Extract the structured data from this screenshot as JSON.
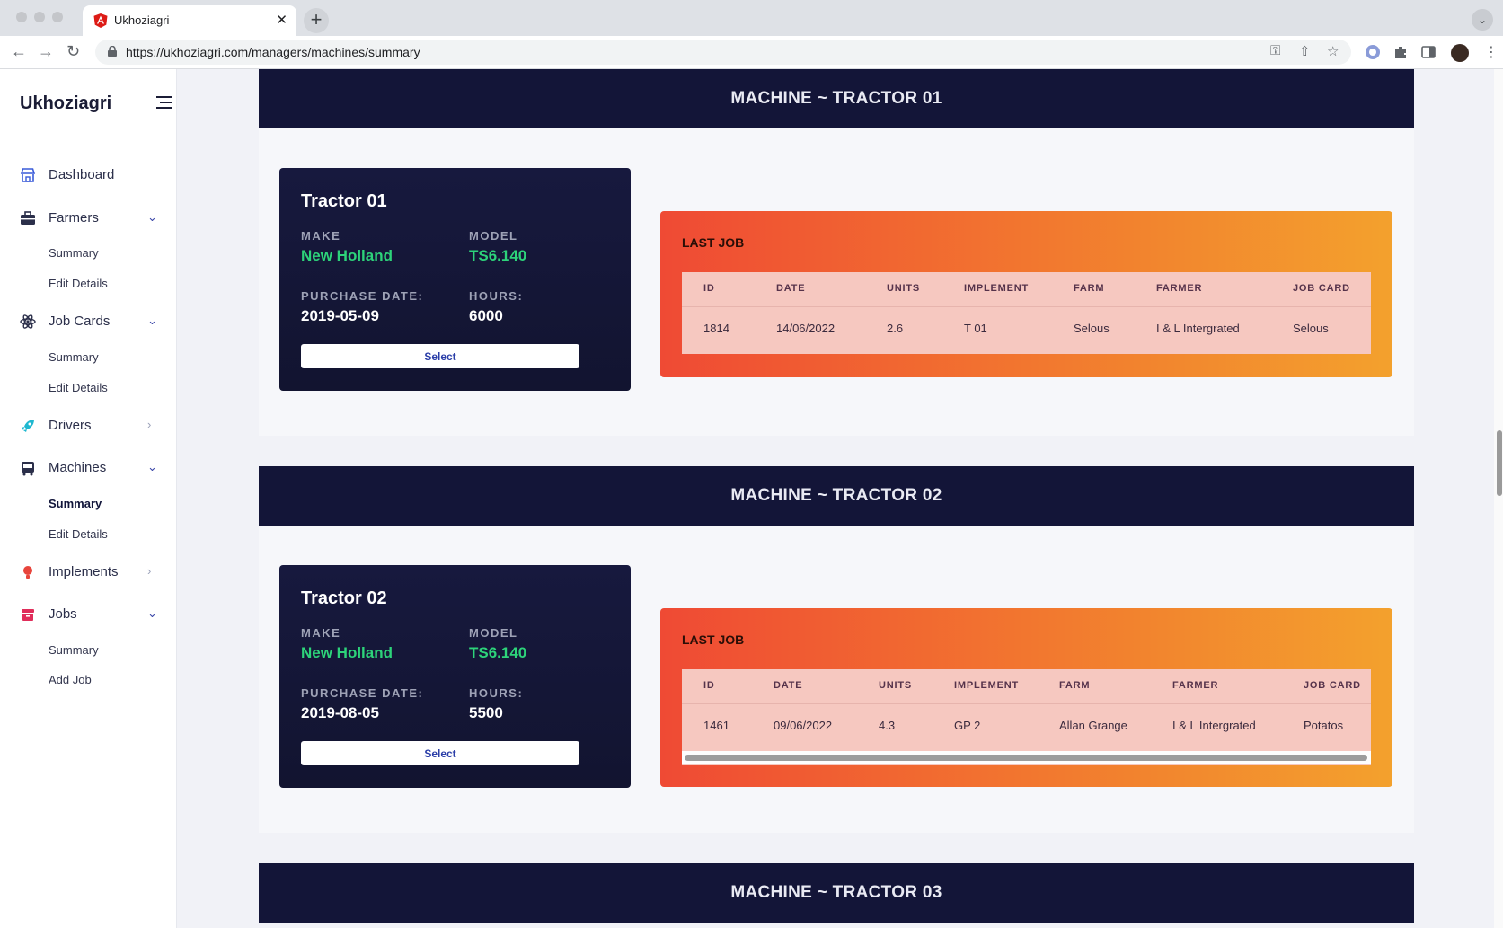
{
  "browser": {
    "tab_title": "Ukhoziagri",
    "url": "https://ukhoziagri.com/managers/machines/summary"
  },
  "sidebar": {
    "brand": "Ukhoziagri",
    "items": [
      {
        "label": "Dashboard",
        "icon": "store-icon",
        "color": "#3a5bd9"
      },
      {
        "label": "Farmers",
        "icon": "briefcase-icon",
        "color": "#2b2f4a",
        "expanded": true,
        "children": [
          "Summary",
          "Edit Details"
        ]
      },
      {
        "label": "Job Cards",
        "icon": "atom-icon",
        "color": "#2b2f4a",
        "expanded": true,
        "children": [
          "Summary",
          "Edit Details"
        ]
      },
      {
        "label": "Drivers",
        "icon": "rocket-icon",
        "color": "#1fb8d0",
        "expanded": false
      },
      {
        "label": "Machines",
        "icon": "bus-icon",
        "color": "#2b2f4a",
        "expanded": true,
        "children": [
          "Summary",
          "Edit Details"
        ],
        "active_child": "Summary"
      },
      {
        "label": "Implements",
        "icon": "bulb-icon",
        "color": "#e8453c",
        "expanded": false
      },
      {
        "label": "Jobs",
        "icon": "archive-icon",
        "color": "#e02d5a",
        "expanded": true,
        "children": [
          "Summary",
          "Add Job"
        ]
      }
    ]
  },
  "machines": [
    {
      "header": "MACHINE ~ TRACTOR 01",
      "name": "Tractor 01",
      "make_label": "MAKE",
      "make": "New Holland",
      "model_label": "MODEL",
      "model": "TS6.140",
      "purchase_label": "PURCHASE DATE:",
      "purchase_date": "2019-05-09",
      "hours_label": "HOURS:",
      "hours": "6000",
      "select_label": "Select",
      "last_job": {
        "title": "LAST JOB",
        "columns": [
          "ID",
          "DATE",
          "UNITS",
          "IMPLEMENT",
          "FARM",
          "FARMER",
          "JOB CARD"
        ],
        "row": [
          "1814",
          "14/06/2022",
          "2.6",
          "T 01",
          "Selous",
          "I & L Intergrated",
          "Selous"
        ]
      }
    },
    {
      "header": "MACHINE ~ TRACTOR 02",
      "name": "Tractor 02",
      "make_label": "MAKE",
      "make": "New Holland",
      "model_label": "MODEL",
      "model": "TS6.140",
      "purchase_label": "PURCHASE DATE:",
      "purchase_date": "2019-08-05",
      "hours_label": "HOURS:",
      "hours": "5500",
      "select_label": "Select",
      "last_job": {
        "title": "LAST JOB",
        "columns": [
          "ID",
          "DATE",
          "UNITS",
          "IMPLEMENT",
          "FARM",
          "FARMER",
          "JOB CARD"
        ],
        "row": [
          "1461",
          "09/06/2022",
          "4.3",
          "GP 2",
          "Allan Grange",
          "I & L Intergrated",
          "Potatos"
        ]
      }
    },
    {
      "header": "MACHINE ~ TRACTOR 03"
    }
  ]
}
